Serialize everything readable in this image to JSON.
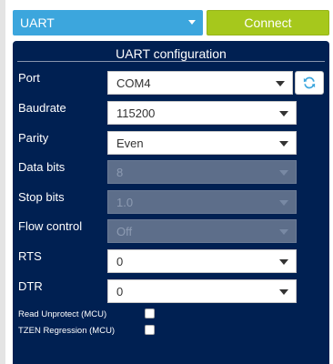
{
  "connection": {
    "type": "UART",
    "connect_label": "Connect"
  },
  "panel": {
    "title": "UART configuration"
  },
  "fields": {
    "port": {
      "label": "Port",
      "value": "COM4"
    },
    "baudrate": {
      "label": "Baudrate",
      "value": "115200"
    },
    "parity": {
      "label": "Parity",
      "value": "Even"
    },
    "data_bits": {
      "label": "Data bits",
      "value": "8",
      "disabled": true
    },
    "stop_bits": {
      "label": "Stop bits",
      "value": "1.0",
      "disabled": true
    },
    "flow_control": {
      "label": "Flow control",
      "value": "Off",
      "disabled": true
    },
    "rts": {
      "label": "RTS",
      "value": "0"
    },
    "dtr": {
      "label": "DTR",
      "value": "0"
    }
  },
  "checkboxes": {
    "read_unprotect": {
      "label": "Read Unprotect (MCU)",
      "checked": false
    },
    "tzen_regression": {
      "label": "TZEN Regression (MCU)",
      "checked": false
    }
  },
  "colors": {
    "accent_blue": "#3ca6dd",
    "connect_green": "#a6c81c",
    "panel_bg": "#002052"
  },
  "icons": {
    "refresh": "refresh-icon",
    "dropdown": "chevron-down-icon"
  }
}
